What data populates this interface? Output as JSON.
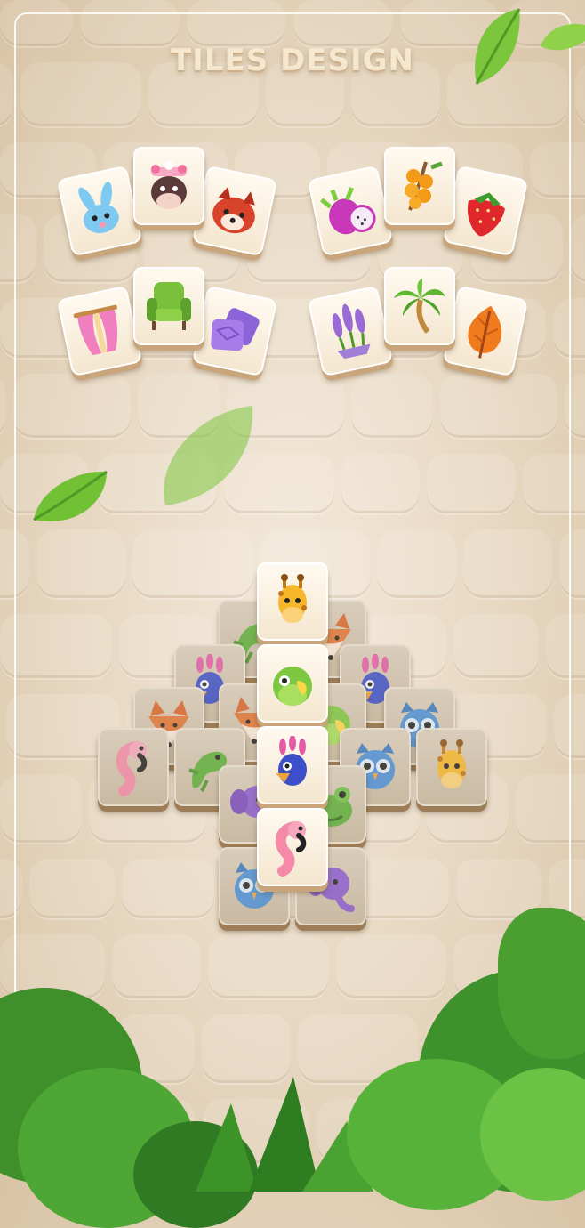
{
  "title": "TILES DESIGN",
  "colors": {
    "background": "#e9dbc6",
    "tile_face": "#fff8ec",
    "tile_edge": "#c8a57a",
    "title_text": "#f5e8cf",
    "leaf_green": "#6fbf3a"
  },
  "tile_sets": [
    {
      "name": "animals",
      "tiles": [
        "rabbit-icon",
        "cow-icon",
        "red-panda-icon"
      ]
    },
    {
      "name": "fruits",
      "tiles": [
        "dragon-fruit-icon",
        "sea-buckthorn-icon",
        "strawberry-icon"
      ]
    },
    {
      "name": "home",
      "tiles": [
        "curtain-icon",
        "armchair-icon",
        "pillow-icon"
      ]
    },
    {
      "name": "plants",
      "tiles": [
        "lavender-icon",
        "palm-tree-icon",
        "autumn-leaf-icon"
      ]
    }
  ],
  "board_tiles": [
    "giraffe-icon",
    "parrot-icon",
    "peacock-icon",
    "flamingo-icon",
    "fox-icon",
    "lizard-icon",
    "owl-icon",
    "elephant-icon",
    "frog-icon"
  ]
}
